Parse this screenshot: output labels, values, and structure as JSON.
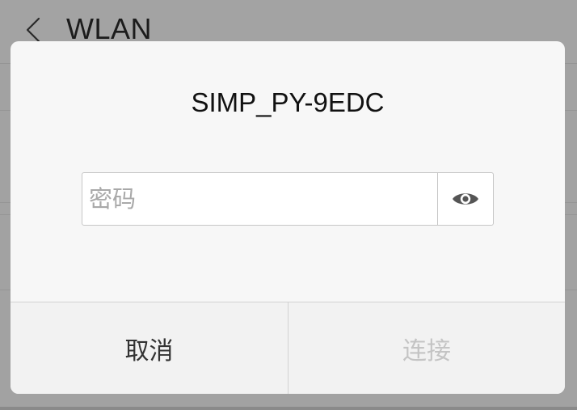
{
  "screen": {
    "title": "WLAN"
  },
  "dialog": {
    "network_name": "SIMP_PY-9EDC",
    "password_placeholder": "密码",
    "password_value": "",
    "cancel_label": "取消",
    "connect_label": "连接",
    "connect_enabled": false
  },
  "icons": {
    "back": "chevron-left-icon",
    "show_password": "eye-icon"
  },
  "colors": {
    "overlay_background": "#a2a2a2",
    "dialog_background": "#f7f7f7",
    "disabled_text": "#c4c4c4"
  }
}
